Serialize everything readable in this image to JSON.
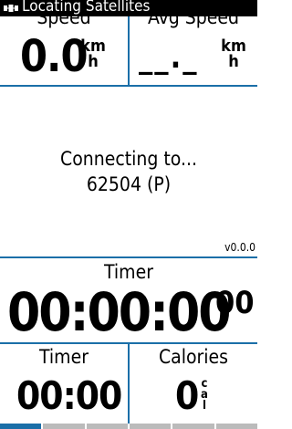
{
  "status_bar": {
    "title": "Locating Satellites",
    "icon": "satellite-icon"
  },
  "speed": {
    "label": "Speed",
    "value": "0.0",
    "unit_top": "km",
    "unit_bottom": "h"
  },
  "avg_speed": {
    "label": "Avg Speed",
    "value": "__._",
    "unit_top": "km",
    "unit_bottom": "h"
  },
  "connection": {
    "line1": "Connecting to...",
    "line2": "62504 (P)"
  },
  "version": "v0.0.0",
  "timer_main": {
    "label": "Timer",
    "value": "00:00:00",
    "fraction": "00"
  },
  "timer_small": {
    "label": "Timer",
    "value": "00:00"
  },
  "calories": {
    "label": "Calories",
    "value": "0",
    "unit": "cal"
  },
  "colors": {
    "accent": "#1b6fa8",
    "status_bg": "#000000",
    "background": "#ffffff"
  },
  "pages": {
    "count": 6,
    "active": 1
  }
}
